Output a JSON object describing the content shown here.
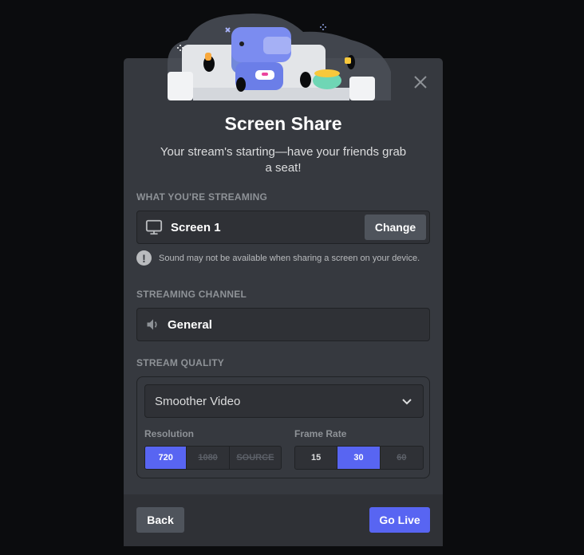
{
  "dialog": {
    "title": "Screen Share",
    "subtitle": "Your stream's starting—have your friends grab a seat!",
    "close_icon": "close-icon",
    "hero_illustration": "couch-watch-party-illustration"
  },
  "streaming_source": {
    "section_label": "What You're Streaming",
    "source_icon": "monitor-icon",
    "source_name": "Screen 1",
    "change_label": "Change",
    "warning_icon": "exclamation-circle-icon",
    "warning_text": "Sound may not be available when sharing a screen on your device."
  },
  "streaming_channel": {
    "section_label": "Streaming Channel",
    "channel_icon": "speaker-icon",
    "channel_name": "General"
  },
  "stream_quality": {
    "section_label": "Stream Quality",
    "preset_selected": "Smoother Video",
    "dropdown_icon": "chevron-down-icon",
    "resolution": {
      "label": "Resolution",
      "options": [
        {
          "label": "720",
          "selected": true,
          "disabled": false
        },
        {
          "label": "1080",
          "selected": false,
          "disabled": true
        },
        {
          "label": "SOURCE",
          "selected": false,
          "disabled": true
        }
      ]
    },
    "frame_rate": {
      "label": "Frame Rate",
      "options": [
        {
          "label": "15",
          "selected": false,
          "disabled": false
        },
        {
          "label": "30",
          "selected": true,
          "disabled": false
        },
        {
          "label": "60",
          "selected": false,
          "disabled": true
        }
      ]
    }
  },
  "footer": {
    "back_label": "Back",
    "go_live_label": "Go Live"
  },
  "colors": {
    "accent": "#5865f2",
    "modal_bg": "#36393f",
    "footer_bg": "#2f3136",
    "secondary_button": "#4f545c",
    "backdrop": "#0b0c0e"
  }
}
